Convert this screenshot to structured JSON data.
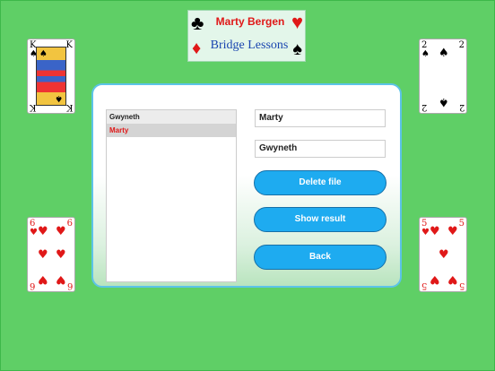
{
  "logo": {
    "line1": "Marty Bergen",
    "line2": "Bridge Lessons",
    "suits": {
      "club": "♣",
      "heart": "♥",
      "diamond": "♦",
      "spade": "♠"
    }
  },
  "cards": {
    "top_left": {
      "rank": "K",
      "suit": "♠"
    },
    "top_right": {
      "rank": "2",
      "suit": "♠"
    },
    "bottom_left": {
      "rank": "6",
      "suit": "♥"
    },
    "bottom_right": {
      "rank": "5",
      "suit": "♥"
    }
  },
  "file_list": {
    "items": [
      "Gwyneth",
      "Marty"
    ],
    "selected_index": 1
  },
  "fields": {
    "name1": "Marty",
    "name2": "Gwyneth"
  },
  "buttons": {
    "delete": "Delete file",
    "show_result": "Show result",
    "back": "Back"
  },
  "colors": {
    "table_green": "#5fcf66",
    "button_blue": "#1eabf0",
    "suit_red": "#e01818",
    "dialog_border": "#5cc3e8"
  }
}
